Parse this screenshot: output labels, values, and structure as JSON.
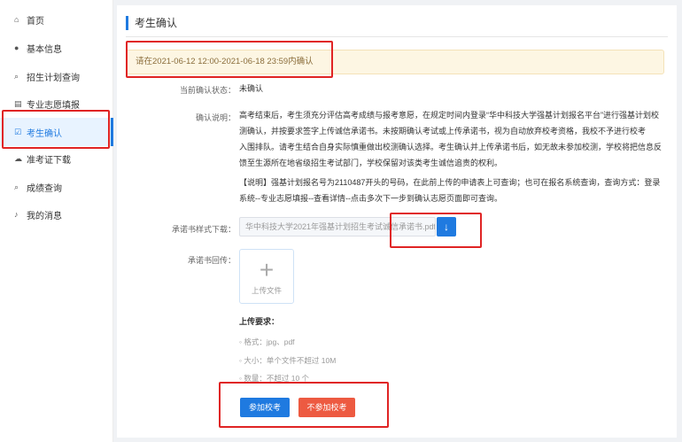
{
  "sidebar": {
    "items": [
      {
        "label": "首页",
        "icon": "home-icon",
        "glyph": "⌂"
      },
      {
        "label": "基本信息",
        "icon": "user-icon",
        "glyph": "●"
      },
      {
        "label": "招生计划查询",
        "icon": "search-icon",
        "glyph": "⌕"
      },
      {
        "label": "专业志愿填报",
        "icon": "document-icon",
        "glyph": "▤"
      },
      {
        "label": "考生确认",
        "icon": "check-square-icon",
        "glyph": "☑"
      },
      {
        "label": "准考证下载",
        "icon": "cloud-download-icon",
        "glyph": "☁"
      },
      {
        "label": "成绩查询",
        "icon": "search-icon",
        "glyph": "⌕"
      },
      {
        "label": "我的消息",
        "icon": "bell-icon",
        "glyph": "♪"
      }
    ],
    "active_index": 4,
    "accent": "#1f7ae0"
  },
  "page": {
    "title": "考生确认",
    "notice": "请在2021-06-12 12:00-2021-06-18 23:59内确认"
  },
  "form": {
    "status_label": "当前确认状态：",
    "status_value": "未确认",
    "desc_label": "确认说明：",
    "desc_p1_lines": [
      "高考结束后，考生须充分评估高考成绩与报考意愿，在规定时间内登录“华中科技大学强基计划报名平台”进行强基计划校",
      "测确认，并按要求签字上传诚信承诺书。未按期确认考试或上传承诺书，视为自动放弃校考资格，我校不予进行校考",
      "入围排队。请考生结合自身实际慎重做出校测确认选择。考生确认并上传承诺书后，如无故未参加校测，学校将把信息反",
      "馈至生源所在地省级招生考试部门，学校保留对该类考生诚信追责的权利。"
    ],
    "desc_p2_lines": [
      "【说明】强基计划报名号为2110487开头的号码，在此前上传的申请表上可查询；也可在报名系统查询，查询方式：登录",
      "系统--专业志愿填报--查看详情--点击多次下一步到确认志愿页面即可查询。"
    ],
    "template_label": "承诺书样式下载：",
    "template_file": "华中科技大学2021年强基计划招生考试诚信承诺书.pdf",
    "upload_label": "承诺书回传：",
    "upload_text": "上传文件",
    "upload_plus": "+",
    "download_glyph": "↓",
    "requirements_title": "上传要求：",
    "requirements": [
      "格式：jpg、pdf",
      "大小：单个文件不超过 10M",
      "数量：不超过 10 个"
    ]
  },
  "actions": {
    "confirm_label": "参加校考",
    "decline_label": "不参加校考",
    "confirm_color": "#1f7ae0",
    "decline_color": "#ed5a41"
  },
  "annotation_color": "#e02424"
}
